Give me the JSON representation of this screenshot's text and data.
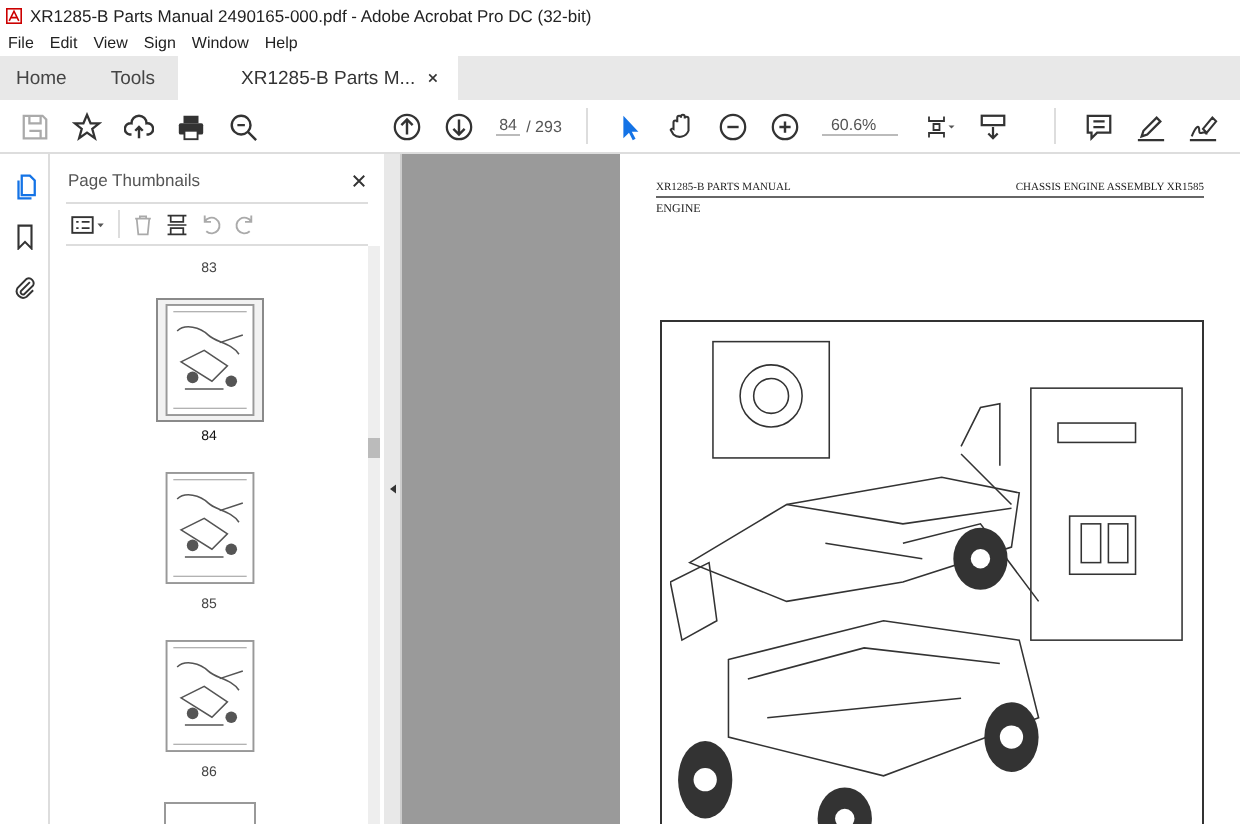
{
  "window": {
    "title": "XR1285-B Parts Manual 2490165-000.pdf - Adobe Acrobat Pro DC (32-bit)"
  },
  "menu": [
    "File",
    "Edit",
    "View",
    "Sign",
    "Window",
    "Help"
  ],
  "tabs": [
    {
      "label": "Home",
      "selected": false
    },
    {
      "label": "Tools",
      "selected": false
    },
    {
      "label": "XR1285-B Parts M...",
      "selected": true
    }
  ],
  "toolbar": {
    "page_current": "84",
    "page_total": "/ 293",
    "zoom": "60.6%"
  },
  "panel": {
    "title": "Page Thumbnails",
    "thumbnails": [
      {
        "label": "83",
        "selected": false
      },
      {
        "label": "84",
        "selected": true
      },
      {
        "label": "85",
        "selected": false
      },
      {
        "label": "86",
        "selected": false
      }
    ]
  },
  "page": {
    "header_left": "XR1285-B PARTS MANUAL",
    "header_right": "CHASSIS ENGINE ASSEMBLY XR1585",
    "section": "ENGINE"
  }
}
